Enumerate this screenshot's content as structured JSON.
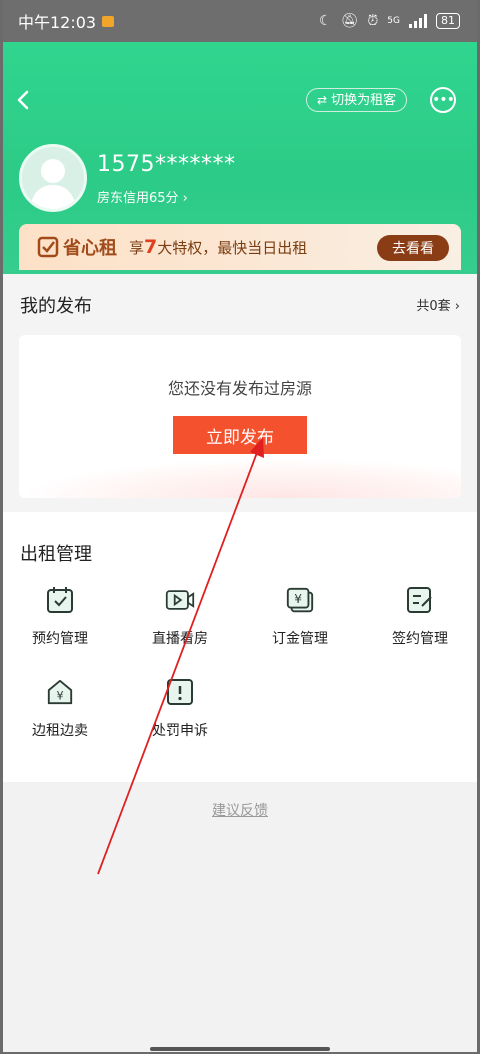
{
  "status_bar": {
    "time": "中午12:03",
    "battery": "81",
    "network": "5G"
  },
  "header": {
    "switch_label": "切换为租客",
    "phone": "1575*******",
    "credit": "房东信用65分 ›"
  },
  "banner": {
    "brand": "省心租",
    "desc_prefix": "享",
    "desc_number": "7",
    "desc_suffix": "大特权，最快当日出租",
    "cta": "去看看"
  },
  "my_publish": {
    "title": "我的发布",
    "count": "共0套 ›",
    "empty_text": "您还没有发布过房源",
    "publish_button": "立即发布"
  },
  "rent_management": {
    "title": "出租管理",
    "items": [
      {
        "label": "预约管理",
        "icon": "calendar-check-icon"
      },
      {
        "label": "直播看房",
        "icon": "video-live-icon"
      },
      {
        "label": "订金管理",
        "icon": "yuan-deposit-icon"
      },
      {
        "label": "签约管理",
        "icon": "contract-edit-icon"
      },
      {
        "label": "边租边卖",
        "icon": "house-yuan-icon"
      },
      {
        "label": "处罚申诉",
        "icon": "alert-appeal-icon"
      }
    ]
  },
  "footer": {
    "feedback": "建议反馈"
  },
  "colors": {
    "brand_green": "#2ccb87",
    "primary_orange": "#f4512f",
    "banner_brown": "#8a3c14",
    "annotation_red": "#e02020"
  }
}
